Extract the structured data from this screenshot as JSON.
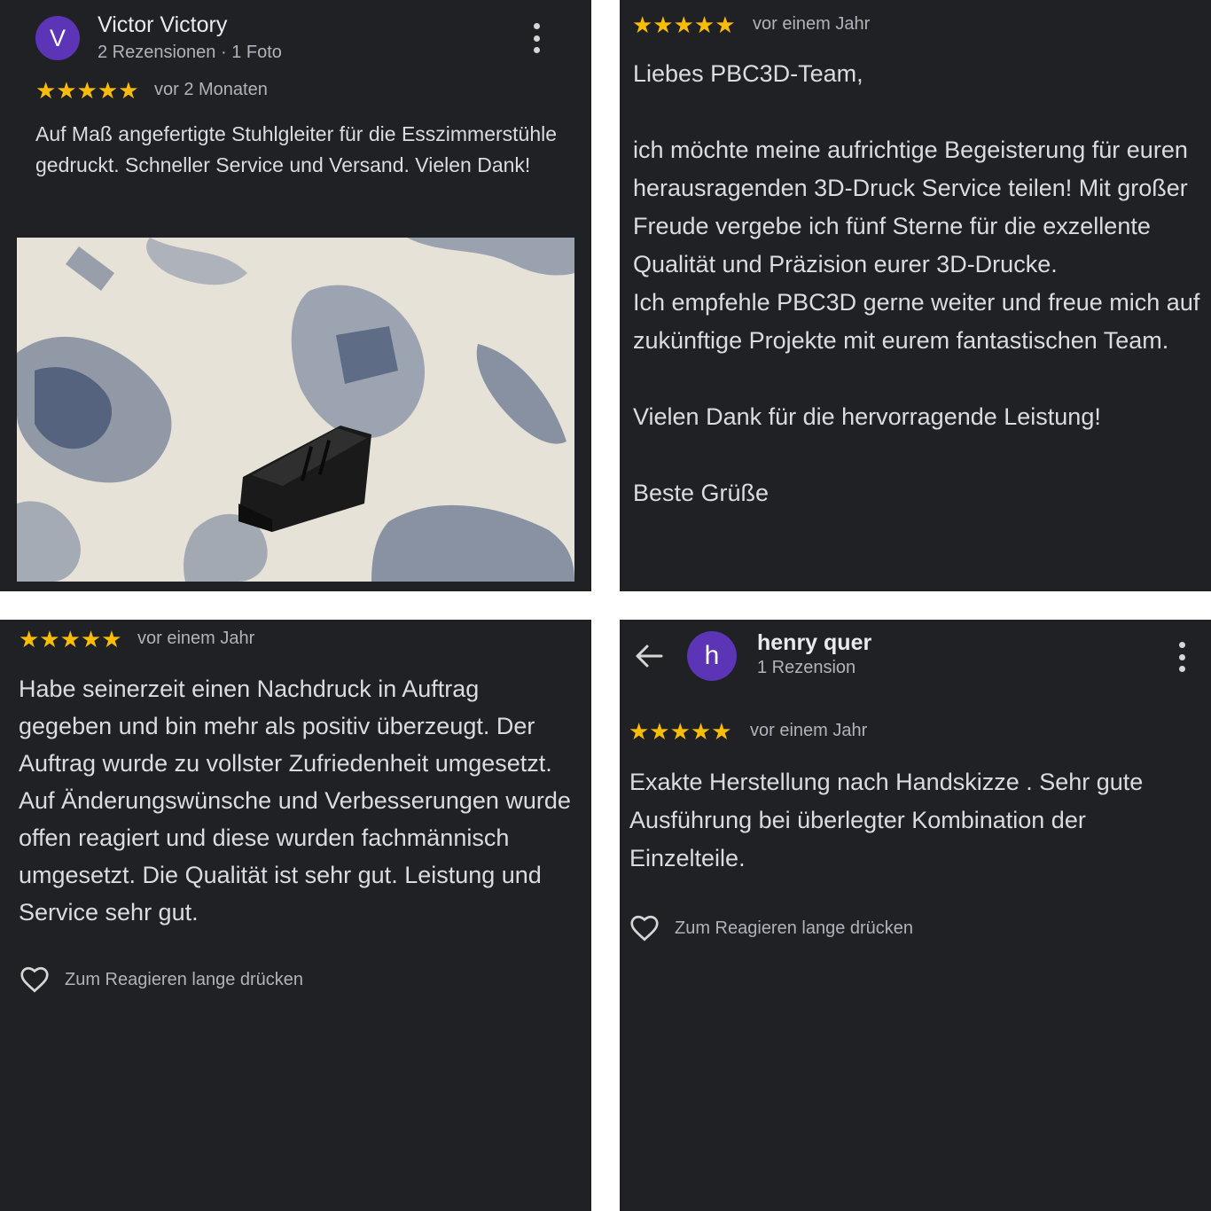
{
  "review1": {
    "avatar_letter": "V",
    "author": "Victor Victory",
    "meta": "2 Rezensionen · 1 Foto",
    "stars": "★★★★★",
    "rating": 5,
    "date": "vor 2 Monaten",
    "text": "Auf Maß angefertigte Stuhlgleiter für die Esszimmerstühle gedruckt. Schneller Service und Versand. Vielen Dank!",
    "photo_icon": "photo-3d-printed-chair-glide"
  },
  "review2": {
    "stars": "★★★★★",
    "rating": 5,
    "date": "vor einem Jahr",
    "paragraphs": [
      "Liebes PBC3D-Team,",
      "ich möchte meine aufrichtige Begeisterung für euren herausragenden 3D-Druck Service teilen! Mit großer Freude vergebe ich fünf Sterne für die exzellente Qualität und Präzision eurer 3D-Drucke.",
      "Ich empfehle PBC3D gerne weiter und freue mich auf zukünftige Projekte mit eurem fantastischen Team.",
      "Vielen Dank für die hervorragende Leistung!",
      "Beste Grüße"
    ]
  },
  "review3": {
    "stars": "★★★★★",
    "rating": 5,
    "date": "vor einem Jahr",
    "text": "Habe seinerzeit einen Nachdruck in Auftrag gegeben und bin mehr als positiv überzeugt. Der Auftrag wurde zu vollster Zufriedenheit umgesetzt. Auf Änderungswünsche und Verbesserungen wurde offen reagiert und diese wurden fachmännisch umgesetzt. Die Qualität ist sehr gut. Leistung und Service sehr gut.",
    "react_label": "Zum Reagieren lange drücken"
  },
  "review4": {
    "avatar_letter": "h",
    "author": "henry quer",
    "meta": "1 Rezension",
    "stars": "★★★★★",
    "rating": 5,
    "date": "vor einem Jahr",
    "text": "Exakte Herstellung nach Handskizze . Sehr gute Ausführung bei überlegter Kombination der Einzelteile.",
    "react_label": "Zum Reagieren lange drücken"
  },
  "colors": {
    "background": "#202124",
    "star": "#fbbc04",
    "avatar": "#5b35b5",
    "text": "#dadce0",
    "muted": "#b0b3b8"
  },
  "icons": [
    "more-vert-icon",
    "back-arrow-icon",
    "heart-outline-icon",
    "star-icon"
  ]
}
